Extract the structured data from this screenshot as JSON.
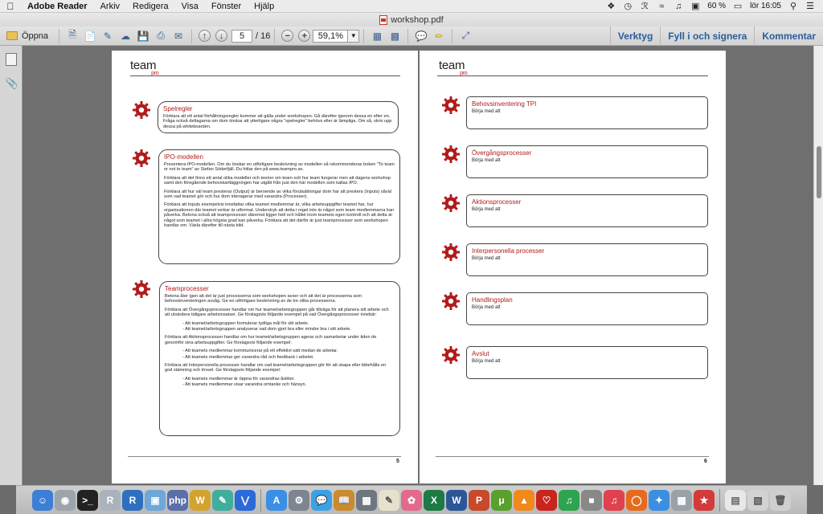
{
  "menubar": {
    "app_name": "Adobe Reader",
    "menus": [
      "Arkiv",
      "Redigera",
      "Visa",
      "Fönster",
      "Hjälp"
    ],
    "status": {
      "battery": "60 %",
      "clock": "lör 16:05"
    }
  },
  "window": {
    "title": "workshop.pdf"
  },
  "toolbar": {
    "open_label": "Öppna",
    "page_current": "5",
    "page_total": "/ 16",
    "zoom": "59,1%",
    "right_links": [
      "Verktyg",
      "Fyll i och signera",
      "Kommentar"
    ]
  },
  "page_left": {
    "logo": "team",
    "logo_sub": "pro",
    "page_number": "5",
    "sections": [
      {
        "title": "Spelregler",
        "paragraphs": [
          "Förklara att ett antal förhållningsregler kommer att gälla under workshopen. Gå därefter igenom dessa en efter en. Fråga också deltagarna om dom önskar att ytterligare några \"spelregler\" behövs eller är lämpliga. Om så, skriv upp dessa på whiteboarden."
        ]
      },
      {
        "title": "IPO-modellen",
        "paragraphs": [
          "Presentera IPO-modellen. Om du önskar en utförligare beskrivning av modellen så rekommenderas boken \"To team or not to team\" av Stefan Söderfjäll. Du hittar den på www.teampro.se.",
          "Förklara att det finns ett antal olika modeller och teorier om team och hur team fungerar men att dagens workshop samt den föregående behovskartläggningen har utgått från just den här modellen som kallas IPO.",
          "Förklara att hur väl team presterar (Output) är beroende av vilka förutsättningar dom har att prestera (Inputs) såväl som vad teamet gör och hur dom interagerar med varandra (Processer).",
          "Förklara att Inputs exempelvis innefattar vilka teamet medlemmar är, vilka arbetsuppgifter teamet har, hur organisationen där teamet verkar är utformat. Understryk att detta i regel inte är något som team medlemmarna kan påverka. Betona också att teamprocesser däremot ligger helt och hållet inom teamets egen kontroll och att detta är något som teamet i allra högsta grad kan påverka. Förklara att det därför är just teamprocesser som workshopen handlar om. Växla därefter till nästa bild."
        ]
      },
      {
        "title": "Teamprocesser",
        "paragraphs": [
          "Betona åter igen att det är just processerna som workshopen avser och att det är processerna som behovsinventeringen avsåg. Ge en utförligare beskrivning av de tre olika processerna.",
          "Förklara att Övergångsprocesser handlar om hur teamet/arbetsgruppen går tillväga för att planera sitt arbete och att utvärdera tidigare arbetsinsatser. Ge förslagsvis följande exempel på vad Övergångsprocesser innebär:"
        ],
        "bullets_1": [
          "- Att teamet/arbetsgruppen formulerar tydliga mål för sitt arbete.",
          "- Att teamet/arbetsgruppen analyserar vad dom gjort bra eller mindre bra i sitt arbete."
        ],
        "paragraph_2": "Förklara att Aktionsprocesser handlar om hur teamet/arbetsgruppen agerar och samarbetar under tiden de genomför sina arbetsuppgifter. Ge förslagsvis följande exempel:",
        "bullets_2": [
          "- Att teamets medlemmar kommunicerar på ett effektivt sätt medan de arbetar.",
          "- Att teamets medlemmar ger varandra råd och feedback i arbetet."
        ],
        "paragraph_3": "Förklara att Interpersonella processer handlar om vad teamet/arbetsgruppen gör för att skapa eller bibehålla en god stämning och trivsel. Ge förslagsvis följande exempel:",
        "bullets_3": [
          "- Att teamets medlemmar är öppna för varandras åsikter.",
          "- Att teamets medlemmar visar varandra omtanke och hänsyn."
        ]
      }
    ]
  },
  "page_right": {
    "logo": "team",
    "logo_sub": "pro",
    "page_number": "6",
    "items": [
      {
        "title": "Behovsinventering TPI",
        "text": "Börja med att"
      },
      {
        "title": "Övergångsprocesser",
        "text": "Börja med att"
      },
      {
        "title": "Aktionsprocesser",
        "text": "Börja med att"
      },
      {
        "title": "Interpersonella processer",
        "text": "Börja med att"
      },
      {
        "title": "Handlingsplan",
        "text": "Börja med att"
      },
      {
        "title": "Avslut",
        "text": "Börja med att"
      }
    ]
  },
  "colors": {
    "accent": "#b11b1b",
    "link": "#2a5d9c"
  }
}
